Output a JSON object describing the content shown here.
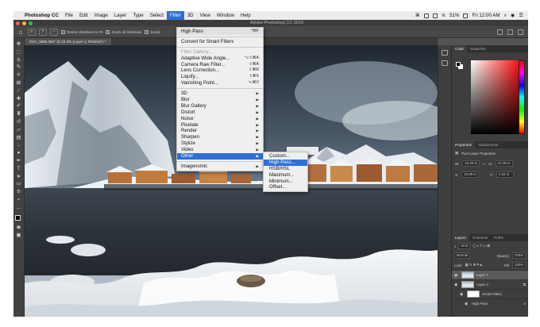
{
  "menubar": {
    "app": "Photoshop CC",
    "items": [
      "File",
      "Edit",
      "Image",
      "Layer",
      "Type",
      "Select",
      "Filter",
      "3D",
      "View",
      "Window",
      "Help"
    ],
    "battery": "51%",
    "clock": "Fri 12:00 AM"
  },
  "titlebar": {
    "title": "Adobe Photoshop CC 2019"
  },
  "options": {
    "resize_windows": "Resize Windows to Fit",
    "zoom_all": "Zoom All Windows",
    "scrubby": "Scrub"
  },
  "document": {
    "tab": "DSC_6980.NEF @ 33.3% (Layer 1, RGB/16*) *"
  },
  "filter_menu": {
    "items": [
      {
        "label": "High Pass",
        "shortcut": "^⌘F"
      },
      {
        "label": "Convert for Smart Filters",
        "shortcut": ""
      },
      {
        "label": "Filter Gallery...",
        "disabled": true
      },
      {
        "label": "Adaptive Wide Angle...",
        "shortcut": "⌥⇧⌘A"
      },
      {
        "label": "Camera Raw Filter...",
        "shortcut": "⇧⌘A"
      },
      {
        "label": "Lens Correction...",
        "shortcut": "⇧⌘R"
      },
      {
        "label": "Liquify...",
        "shortcut": "⇧⌘X"
      },
      {
        "label": "Vanishing Point...",
        "shortcut": "⌥⌘V"
      },
      {
        "label": "3D"
      },
      {
        "label": "Blur"
      },
      {
        "label": "Blur Gallery"
      },
      {
        "label": "Distort"
      },
      {
        "label": "Noise"
      },
      {
        "label": "Pixelate"
      },
      {
        "label": "Render"
      },
      {
        "label": "Sharpen"
      },
      {
        "label": "Stylize"
      },
      {
        "label": "Video"
      },
      {
        "label": "Other"
      },
      {
        "label": "Imagenomic"
      }
    ]
  },
  "other_submenu": {
    "items": [
      "Custom...",
      "High Pass...",
      "HSB/HSL",
      "Maximum...",
      "Minimum...",
      "Offset..."
    ]
  },
  "panels": {
    "color_tabs": [
      "Color",
      "Swatches"
    ],
    "props_tabs": [
      "Properties",
      "Adjustments"
    ],
    "props_title": "Pixel Layer Properties",
    "w_label": "W:",
    "w_value": "15.39 in",
    "h_label": "H:",
    "h_value": "21.05 in",
    "x_label": "X:",
    "x_value": "15.39 in",
    "y_label": "Y:",
    "y_value": "0.22 in",
    "layers_tabs": [
      "Layers",
      "Channels",
      "Paths"
    ],
    "kind": "Kind",
    "blend": "Normal",
    "opacity_label": "Opacity:",
    "opacity": "100%",
    "lock_label": "Lock:",
    "fill_label": "Fill:",
    "fill": "100%",
    "layers": [
      {
        "name": "Layer 1"
      },
      {
        "name": "Layer 0"
      },
      {
        "name": "Smart Filters"
      },
      {
        "name": "High Pass"
      }
    ]
  },
  "colors": {
    "menu_highlight": "#2f6fd6",
    "ui_dark": "#535353"
  }
}
